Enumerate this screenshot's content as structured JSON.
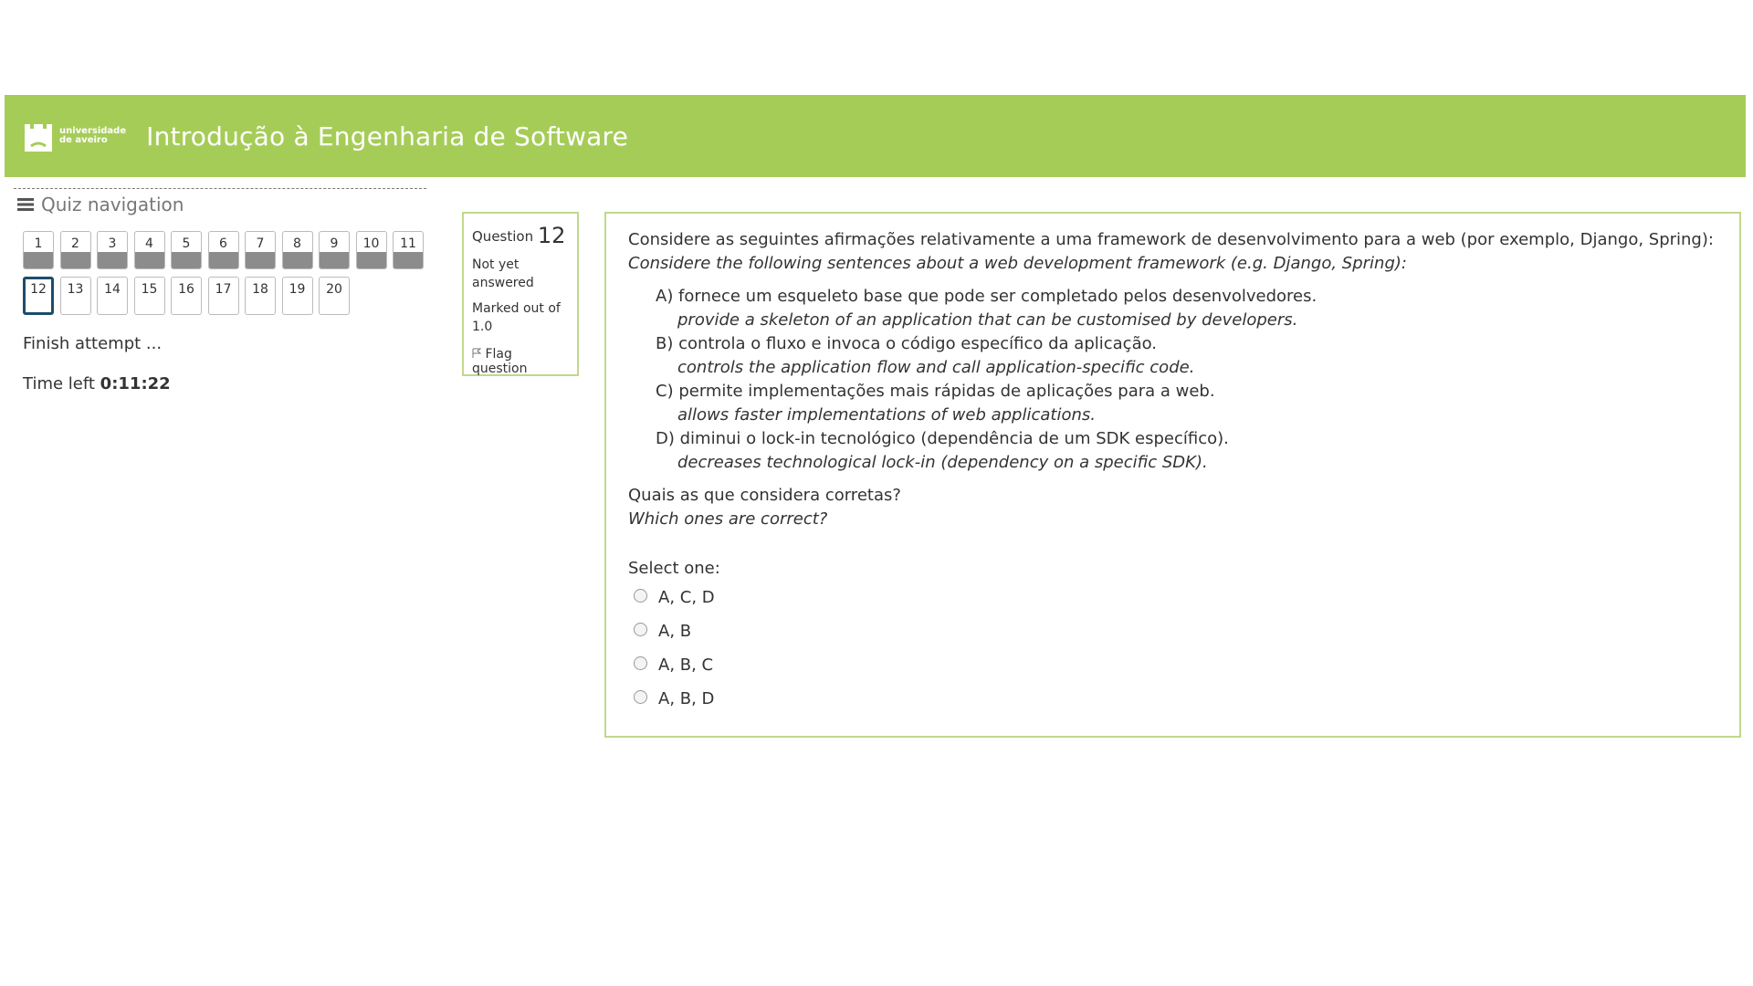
{
  "header": {
    "logo_line1": "universidade",
    "logo_line2": "de aveiro",
    "course_title": "Introdução à Engenharia de Software"
  },
  "quiz_nav": {
    "title": "Quiz navigation",
    "buttons": [
      {
        "label": "1",
        "state": "answered"
      },
      {
        "label": "2",
        "state": "answered"
      },
      {
        "label": "3",
        "state": "answered"
      },
      {
        "label": "4",
        "state": "answered"
      },
      {
        "label": "5",
        "state": "answered"
      },
      {
        "label": "6",
        "state": "answered"
      },
      {
        "label": "7",
        "state": "answered"
      },
      {
        "label": "8",
        "state": "answered"
      },
      {
        "label": "9",
        "state": "answered"
      },
      {
        "label": "10",
        "state": "answered"
      },
      {
        "label": "11",
        "state": "answered"
      },
      {
        "label": "12",
        "state": "current"
      },
      {
        "label": "13",
        "state": "unanswered"
      },
      {
        "label": "14",
        "state": "unanswered"
      },
      {
        "label": "15",
        "state": "unanswered"
      },
      {
        "label": "16",
        "state": "unanswered"
      },
      {
        "label": "17",
        "state": "unanswered"
      },
      {
        "label": "18",
        "state": "unanswered"
      },
      {
        "label": "19",
        "state": "unanswered"
      },
      {
        "label": "20",
        "state": "unanswered"
      }
    ],
    "finish_label": "Finish attempt ...",
    "time_label": "Time left",
    "time_value": "0:11:22"
  },
  "question_info": {
    "question_word": "Question",
    "number": "12",
    "status_line1": "Not yet",
    "status_line2": "answered",
    "marked_line1": "Marked out of",
    "marked_line2": "1.0",
    "flag_label": "Flag question"
  },
  "question": {
    "intro_pt": "Considere as seguintes afirmações relativamente a uma framework de desenvolvimento para a web (por exemplo, Django, Spring):",
    "intro_en": "Considere the following sentences about a web development framework (e.g. Django, Spring):",
    "statements": [
      {
        "pt": "A) fornece um esqueleto base que pode ser completado pelos desenvolvedores.",
        "en": "provide a skeleton of an application that can be customised by developers."
      },
      {
        "pt": "B) controla o fluxo e invoca o código específico da aplicação.",
        "en": "controls the application flow and call application-specific code."
      },
      {
        "pt": "C) permite implementações mais rápidas de aplicações para a web.",
        "en": "allows faster implementations of web applications."
      },
      {
        "pt": "D) diminui o lock-in tecnológico (dependência de um SDK específico).",
        "en": "decreases technological lock-in (dependency on a specific SDK)."
      }
    ],
    "ask_pt": "Quais as que considera corretas?",
    "ask_en": "Which ones are correct?",
    "select_label": "Select one:",
    "options": [
      "A, C, D",
      "A, B",
      "A, B, C",
      "A, B, D"
    ]
  },
  "colors": {
    "header_bg": "#a6cc58",
    "box_border": "#c1d88b",
    "current_border": "#1d4c6c",
    "answered_fill": "#8c8c8c"
  }
}
